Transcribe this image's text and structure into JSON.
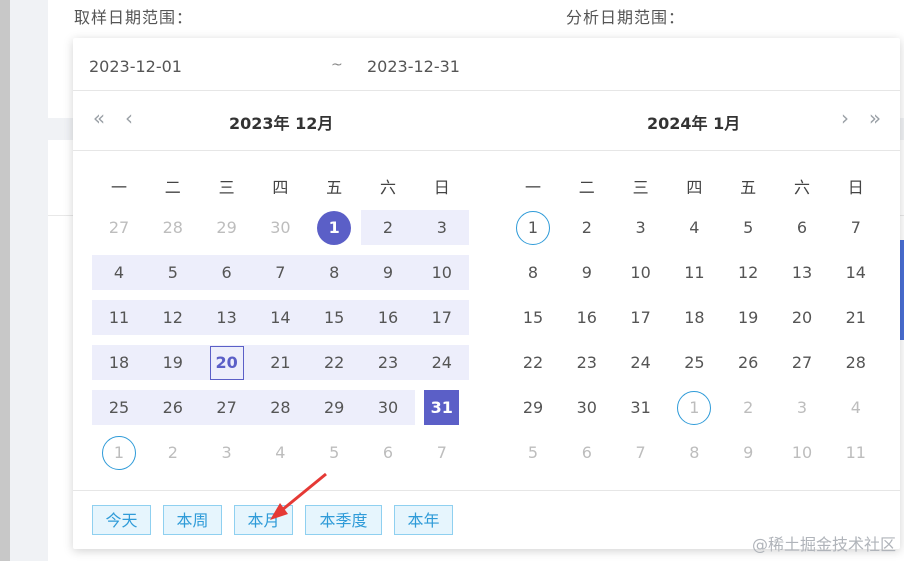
{
  "form": {
    "sample_label": "取样日期范围：",
    "analysis_label": "分析日期范围："
  },
  "picker": {
    "start_value": "2023-12-01",
    "separator": "~",
    "end_value": "2023-12-31",
    "nav": {
      "prev_year_icon": "double-chevron-left",
      "prev_month_icon": "chevron-left",
      "next_month_icon": "chevron-right",
      "next_year_icon": "double-chevron-right"
    },
    "left_title": "2023年 12月",
    "right_title": "2024年 1月",
    "weekdays": [
      "一",
      "二",
      "三",
      "四",
      "五",
      "六",
      "日"
    ],
    "left_days": [
      [
        "27",
        "28",
        "29",
        "30",
        "1",
        "2",
        "3"
      ],
      [
        "4",
        "5",
        "6",
        "7",
        "8",
        "9",
        "10"
      ],
      [
        "11",
        "12",
        "13",
        "14",
        "15",
        "16",
        "17"
      ],
      [
        "18",
        "19",
        "20",
        "21",
        "22",
        "23",
        "24"
      ],
      [
        "25",
        "26",
        "27",
        "28",
        "29",
        "30",
        "31"
      ],
      [
        "1",
        "2",
        "3",
        "4",
        "5",
        "6",
        "7"
      ]
    ],
    "right_days": [
      [
        "1",
        "2",
        "3",
        "4",
        "5",
        "6",
        "7"
      ],
      [
        "8",
        "9",
        "10",
        "11",
        "12",
        "13",
        "14"
      ],
      [
        "15",
        "16",
        "17",
        "18",
        "19",
        "20",
        "21"
      ],
      [
        "22",
        "23",
        "24",
        "25",
        "26",
        "27",
        "28"
      ],
      [
        "29",
        "30",
        "31",
        "1",
        "2",
        "3",
        "4"
      ],
      [
        "5",
        "6",
        "7",
        "8",
        "9",
        "10",
        "11"
      ]
    ],
    "presets": [
      "今天",
      "本周",
      "本月",
      "本季度",
      "本年"
    ],
    "colors": {
      "accent": "#5b5fc7",
      "range": "#edeefb",
      "preset": "#2f9bd8"
    }
  },
  "watermark": "@稀土掘金技术社区"
}
